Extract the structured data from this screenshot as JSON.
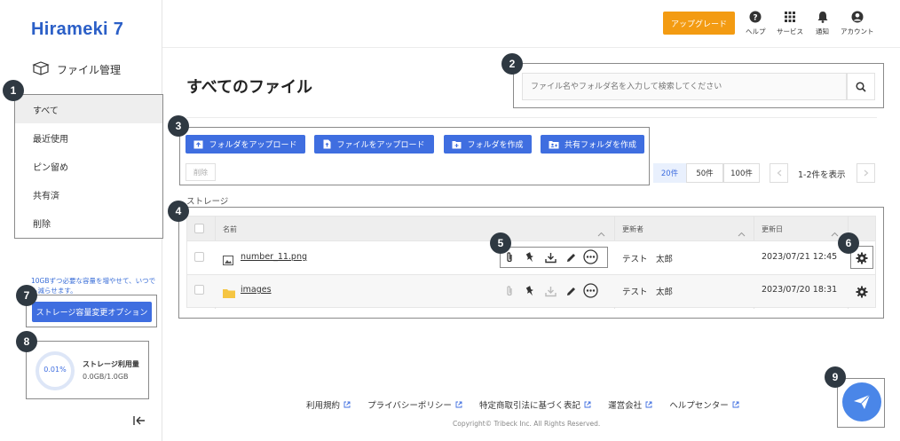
{
  "logo": {
    "text": "Hirameki 7"
  },
  "sidebar": {
    "heading": "ファイル管理",
    "items": [
      {
        "label": "すべて"
      },
      {
        "label": "最近使用"
      },
      {
        "label": "ピン留め"
      },
      {
        "label": "共有済"
      },
      {
        "label": "削除"
      }
    ],
    "promo_text": "10GBずつ必要な容量を増やせて、いつでも減らせます。",
    "storage_option_button": "ストレージ容量変更オプション",
    "usage": {
      "percent": "0.01%",
      "fraction": 0.0001,
      "title": "ストレージ利用量",
      "detail": "0.0GB/1.0GB"
    }
  },
  "header": {
    "upgrade_label": "アップグレード",
    "icons": [
      {
        "label": "ヘルプ",
        "icon": "help-icon"
      },
      {
        "label": "サービス",
        "icon": "grid-icon"
      },
      {
        "label": "通知",
        "icon": "bell-icon"
      },
      {
        "label": "アカウント",
        "icon": "account-icon"
      }
    ]
  },
  "main": {
    "title": "すべてのファイル",
    "search_placeholder": "ファイル名やフォルダ名を入力して検索してください",
    "actions": {
      "upload_folder": "フォルダをアップロード",
      "upload_file": "ファイルをアップロード",
      "create_folder": "フォルダを作成",
      "create_shared_folder": "共有フォルダを作成",
      "delete": "削除"
    },
    "pager": {
      "sizes": [
        "20件",
        "50件",
        "100件"
      ],
      "active": "20件",
      "range_text": "1-2件を表示"
    },
    "storage_label": "ストレージ",
    "table": {
      "headers": {
        "name": "名前",
        "updater": "更新者",
        "updated": "更新日"
      },
      "rows": [
        {
          "name": "number_11.png",
          "type": "image",
          "updater": "テスト　太郎",
          "updated": "2023/07/21 12:45"
        },
        {
          "name": "images",
          "type": "folder",
          "updater": "テスト　太郎",
          "updated": "2023/07/20 18:31"
        }
      ]
    }
  },
  "markers": [
    "1",
    "2",
    "3",
    "4",
    "5",
    "6",
    "7",
    "8",
    "9"
  ],
  "footer": {
    "links": [
      "利用規約",
      "プライバシーポリシー",
      "特定商取引法に基づく表記",
      "運営会社",
      "ヘルプセンター"
    ],
    "copyright": "Copyright© Tribeck Inc. All Rights Reserved."
  },
  "colors": {
    "accent": "#3f6ee0",
    "upgrade": "#f39b12",
    "marker": "#2f3942",
    "folder": "#f5c542"
  }
}
